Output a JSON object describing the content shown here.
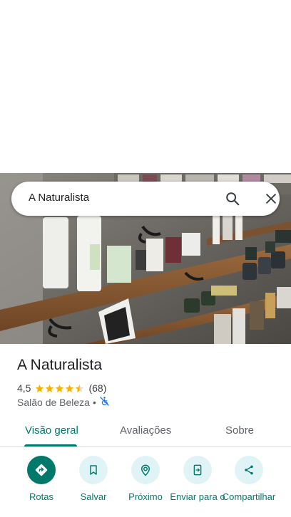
{
  "search": {
    "query": "A Naturalista",
    "search_icon": "search-icon",
    "close_icon": "close-icon"
  },
  "place": {
    "name": "A Naturalista",
    "rating": "4,5",
    "stars": 4.5,
    "review_count": "(68)",
    "category": "Salão de Beleza",
    "separator": "•",
    "accessibility_icon": "not-accessible-icon"
  },
  "tabs": [
    {
      "label": "Visão geral",
      "active": true
    },
    {
      "label": "Avaliações",
      "active": false
    },
    {
      "label": "Sobre",
      "active": false
    }
  ],
  "actions": [
    {
      "label": "Rotas",
      "icon": "directions-icon"
    },
    {
      "label": "Salvar",
      "icon": "bookmark-icon"
    },
    {
      "label": "Próximo",
      "icon": "nearby-icon"
    },
    {
      "label": "Enviar para o",
      "icon": "send-to-phone-icon"
    },
    {
      "label": "Compartilhar",
      "icon": "share-icon"
    }
  ],
  "colors": {
    "accent": "#00796b",
    "action_bg": "#e0f4f7",
    "star": "#f5b301"
  }
}
